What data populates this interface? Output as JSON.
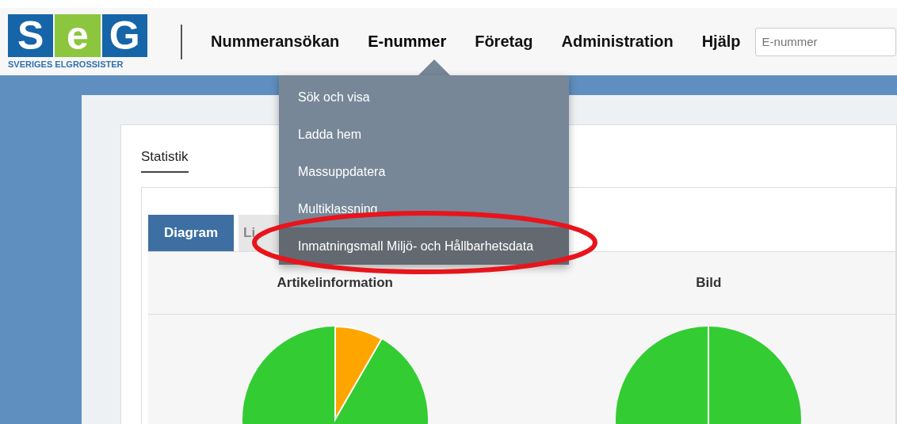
{
  "logo": {
    "letters": [
      "S",
      "e",
      "G"
    ],
    "tagline": "SVERIGES ELGROSSISTER"
  },
  "nav": [
    {
      "label": "Nummeransökan",
      "selected": false
    },
    {
      "label": "E-nummer",
      "selected": true
    },
    {
      "label": "Företag",
      "selected": false
    },
    {
      "label": "Administration",
      "selected": false
    },
    {
      "label": "Hjälp",
      "selected": false
    }
  ],
  "search": {
    "placeholder": "E-nummer"
  },
  "dropdown": [
    {
      "label": "Sök och visa",
      "selected": false
    },
    {
      "label": "Ladda hem",
      "selected": false
    },
    {
      "label": "Massuppdatera",
      "selected": false
    },
    {
      "label": "Multiklassning",
      "selected": false
    },
    {
      "label": "Inmatningsmall Miljö- och Hållbarhetsdata",
      "selected": true
    }
  ],
  "page_tabs": [
    {
      "label": "Statistik",
      "selected": true
    }
  ],
  "view_tabs": [
    {
      "label": "Diagram",
      "selected": true
    },
    {
      "label": "Li",
      "selected": false
    }
  ],
  "charts": [
    {
      "title": "Artikelinformation",
      "kind": "split"
    },
    {
      "title": "Bild",
      "kind": "full"
    }
  ]
}
